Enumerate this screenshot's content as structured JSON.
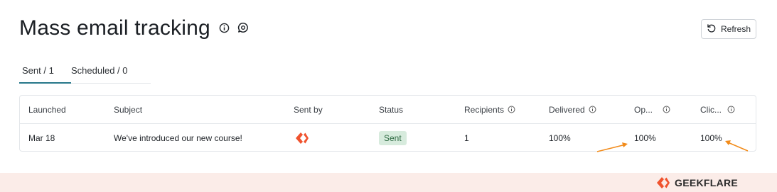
{
  "page": {
    "title": "Mass email tracking",
    "icons": [
      "info-icon",
      "feedback-icon"
    ]
  },
  "toolbar": {
    "refresh_label": "Refresh"
  },
  "tabs": [
    {
      "label": "Sent / 1",
      "active": true
    },
    {
      "label": "Scheduled / 0",
      "active": false
    }
  ],
  "table": {
    "columns": [
      {
        "label": "Launched",
        "info": false
      },
      {
        "label": "Subject",
        "info": false
      },
      {
        "label": "Sent by",
        "info": false
      },
      {
        "label": "Status",
        "info": false
      },
      {
        "label": "Recipients",
        "info": true
      },
      {
        "label": "Delivered",
        "info": true
      },
      {
        "label": "Op...",
        "info": true
      },
      {
        "label": "Clic...",
        "info": true
      }
    ],
    "rows": [
      {
        "launched": "Mar 18",
        "subject": "We've introduced our new course!",
        "sent_by_icon": "geekflare-logo-icon",
        "status": "Sent",
        "recipients": "1",
        "delivered": "100%",
        "opened": "100%",
        "clicked": "100%"
      }
    ]
  },
  "annotations": {
    "arrow_color": "#f28b1a"
  },
  "footer": {
    "brand": "GEEKFLARE",
    "brand_color": "#f0532e"
  },
  "colors": {
    "tab_active_underline": "#27788a",
    "status_sent_bg": "#d7ebdd",
    "status_sent_text": "#2f6b43",
    "footer_bg": "#fbece8"
  }
}
